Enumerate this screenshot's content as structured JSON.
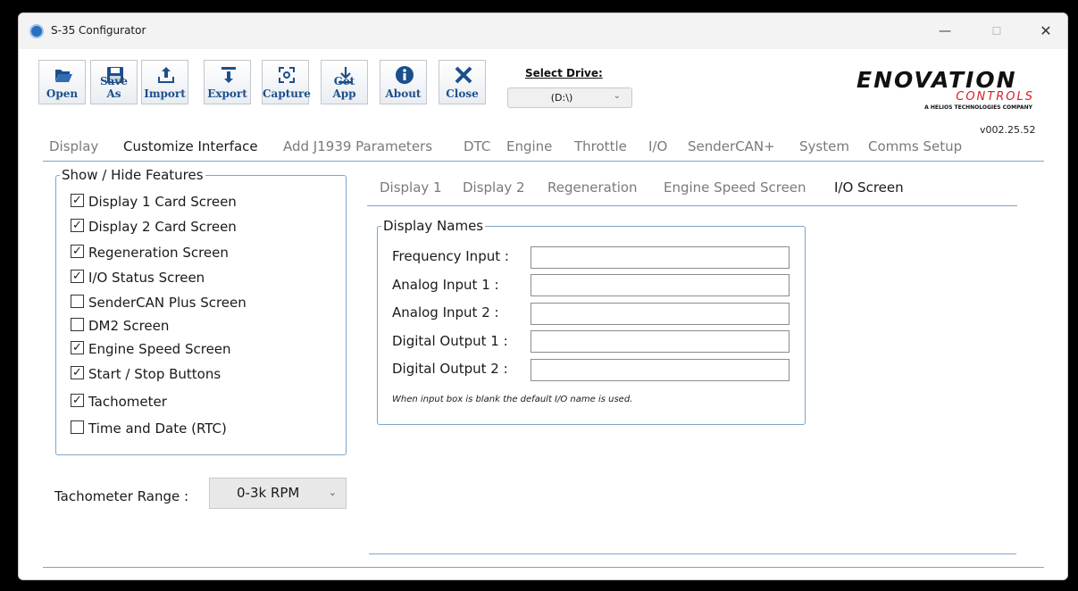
{
  "window": {
    "title": "S-35 Configurator",
    "controls": {
      "minimize": "—",
      "maximize": "☐",
      "close": "✕"
    }
  },
  "toolbar": {
    "buttons": [
      {
        "label": "Open",
        "icon": "folder-open-icon"
      },
      {
        "label": "Save As",
        "icon": "floppy-disk-icon"
      },
      {
        "label": "Import",
        "icon": "upload-tray-icon"
      },
      {
        "label": "Export",
        "icon": "download-tray-icon"
      },
      {
        "label": "Capture",
        "icon": "capture-frame-icon"
      },
      {
        "label": "Get App",
        "icon": "download-arrow-icon"
      },
      {
        "label": "About",
        "icon": "info-icon"
      },
      {
        "label": "Close",
        "icon": "close-x-icon"
      }
    ],
    "accent_color": "#1c4f8c"
  },
  "drive": {
    "label": "Select Drive:",
    "selected": "(D:\\)"
  },
  "logo": {
    "brand": "ENOVATION",
    "sub": "CONTROLS",
    "tagline": "A HELIOS TECHNOLOGIES COMPANY",
    "brand_color": "#d51f26"
  },
  "version": "v002.25.52",
  "main_tabs": [
    {
      "label": "Display",
      "active": false
    },
    {
      "label": "Customize Interface",
      "active": true
    },
    {
      "label": "Add J1939 Parameters",
      "active": false
    },
    {
      "label": "DTC",
      "active": false
    },
    {
      "label": "Engine",
      "active": false
    },
    {
      "label": "Throttle",
      "active": false
    },
    {
      "label": "I/O",
      "active": false
    },
    {
      "label": "SenderCAN+",
      "active": false
    },
    {
      "label": "System",
      "active": false
    },
    {
      "label": "Comms Setup",
      "active": false
    }
  ],
  "features": {
    "title": "Show / Hide Features",
    "items": [
      {
        "label": "Display 1 Card Screen",
        "checked": true
      },
      {
        "label": "Display 2 Card Screen",
        "checked": true
      },
      {
        "label": "Regeneration Screen",
        "checked": true
      },
      {
        "label": "I/O Status Screen",
        "checked": true
      },
      {
        "label": "SenderCAN Plus Screen",
        "checked": false
      },
      {
        "label": "DM2 Screen",
        "checked": false
      },
      {
        "label": "Engine Speed Screen",
        "checked": true
      },
      {
        "label": "Start / Stop Buttons",
        "checked": true
      },
      {
        "label": "Tachometer",
        "checked": true
      },
      {
        "label": "Time and Date (RTC)",
        "checked": false
      }
    ]
  },
  "tachometer": {
    "label": "Tachometer Range :",
    "selected": "0-3k RPM"
  },
  "sub_tabs": [
    {
      "label": "Display 1",
      "active": false
    },
    {
      "label": "Display 2",
      "active": false
    },
    {
      "label": "Regeneration",
      "active": false
    },
    {
      "label": "Engine Speed Screen",
      "active": false
    },
    {
      "label": "I/O Screen",
      "active": true
    }
  ],
  "display_names": {
    "title": "Display Names",
    "fields": [
      {
        "label": "Frequency Input :",
        "value": ""
      },
      {
        "label": "Analog Input 1 :",
        "value": ""
      },
      {
        "label": "Analog Input 2 :",
        "value": ""
      },
      {
        "label": "Digital Output 1 :",
        "value": ""
      },
      {
        "label": "Digital Output 2 :",
        "value": ""
      }
    ],
    "note": "When input box is blank the default I/O name is used."
  }
}
